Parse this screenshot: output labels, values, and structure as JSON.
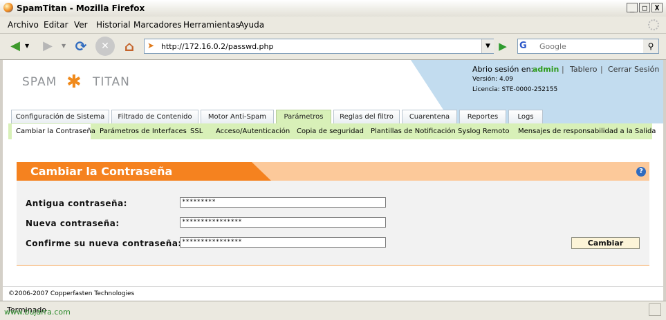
{
  "window": {
    "title": "SpamTitan - Mozilla Firefox",
    "buttons": {
      "minimize": "_",
      "maximize": "□",
      "close": "X"
    }
  },
  "menu": [
    "Archivo",
    "Editar",
    "Ver",
    "Historial",
    "Marcadores",
    "Herramientas",
    "Ayuda"
  ],
  "navbar": {
    "url": "http://172.16.0.2/passwd.php",
    "search_placeholder": "Google",
    "search_engine_letter": "G"
  },
  "header": {
    "logo_left": "SPAM",
    "logo_right": "TITAN",
    "session_label": "Abrio sesión en:",
    "session_user": "admin",
    "separator": "|",
    "link_dashboard": "Tablero",
    "link_logout": "Cerrar Sesión",
    "version": "Versión: 4.09",
    "license": "Licencia: STE-0000-252155"
  },
  "tabs": [
    {
      "label": "Configuración de Sistema"
    },
    {
      "label": "Filtrado de Contenido"
    },
    {
      "label": "Motor Anti-Spam"
    },
    {
      "label": "Parámetros"
    },
    {
      "label": "Reglas del filtro"
    },
    {
      "label": "Cuarentena"
    },
    {
      "label": "Reportes"
    },
    {
      "label": "Logs"
    }
  ],
  "active_tab": "Parámetros",
  "subtabs": [
    {
      "label": "Cambiar la Contraseña"
    },
    {
      "label": "Parámetros de Interfaces"
    },
    {
      "label": "SSL"
    },
    {
      "label": "Acceso/Autenticación"
    },
    {
      "label": "Copia de seguridad"
    },
    {
      "label": "Plantillas de Notificación"
    },
    {
      "label": "Syslog Remoto"
    },
    {
      "label": "Mensajes de responsabilidad a la Salida"
    }
  ],
  "form": {
    "title": "Cambiar la Contraseña",
    "help": "?",
    "old_password_label": "Antigua contraseña:",
    "old_password_value": "*********",
    "new_password_label": "Nueva contraseña:",
    "new_password_value": "****************",
    "confirm_password_label": "Confirme su nueva contraseña:",
    "confirm_password_value": "****************",
    "submit_label": "Cambiar"
  },
  "footer": "©2006-2007 Copperfasten Technologies",
  "status": "Terminado",
  "watermark": "www.bujarra.com",
  "colors": {
    "accent_orange": "#f5821f",
    "tab_green": "#d8f0b8",
    "header_blue": "#c2dcef",
    "admin_green": "#2f9b1c"
  }
}
